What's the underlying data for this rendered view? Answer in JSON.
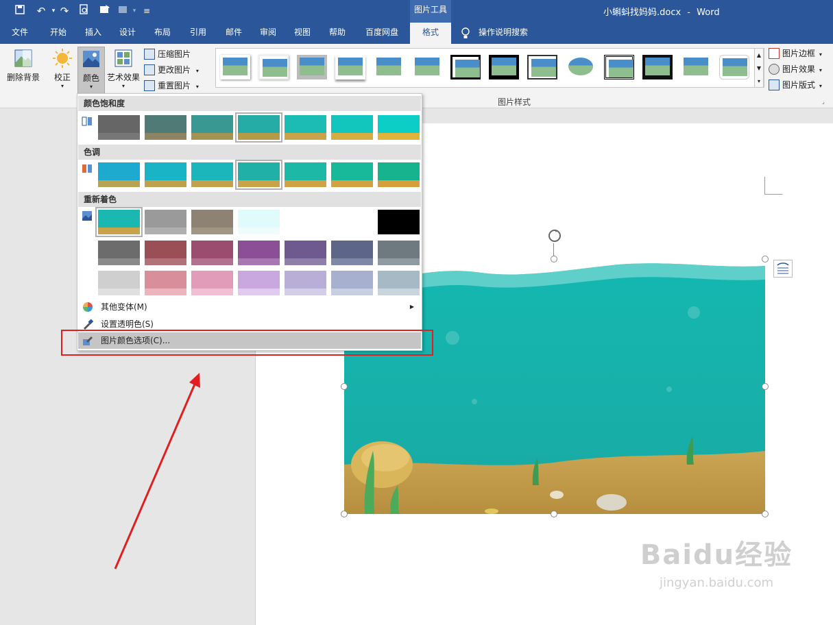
{
  "window": {
    "document_title": "小蝌蚪找妈妈.docx",
    "app_name": "Word",
    "separator": "-",
    "context_group": "图片工具"
  },
  "tabs": [
    "文件",
    "开始",
    "插入",
    "设计",
    "布局",
    "引用",
    "邮件",
    "审阅",
    "视图",
    "帮助",
    "百度网盘",
    "格式"
  ],
  "active_tab": "格式",
  "tell_me": "操作说明搜索",
  "ribbon": {
    "remove_bg": "删除背景",
    "corrections": "校正",
    "color": "颜色",
    "artistic": "艺术效果",
    "compress": "压缩图片",
    "change": "更改图片",
    "reset": "重置图片",
    "border": "图片边框",
    "effects": "图片效果",
    "layout": "图片版式",
    "styles_group_label": "图片样式"
  },
  "dropdown": {
    "saturation_header": "颜色饱和度",
    "tone_header": "色调",
    "recolor_header": "重新着色",
    "more_variations": "其他变体(M)",
    "set_transparent": "设置透明色(S)",
    "color_options": "图片颜色选项(C)..."
  },
  "colors": {
    "accent": "#2b579a",
    "highlight": "#e02020",
    "water": "#14b4ae",
    "sand": "#c9a34a"
  },
  "watermark": {
    "brand": "Baidu经验",
    "url": "jingyan.baidu.com"
  }
}
